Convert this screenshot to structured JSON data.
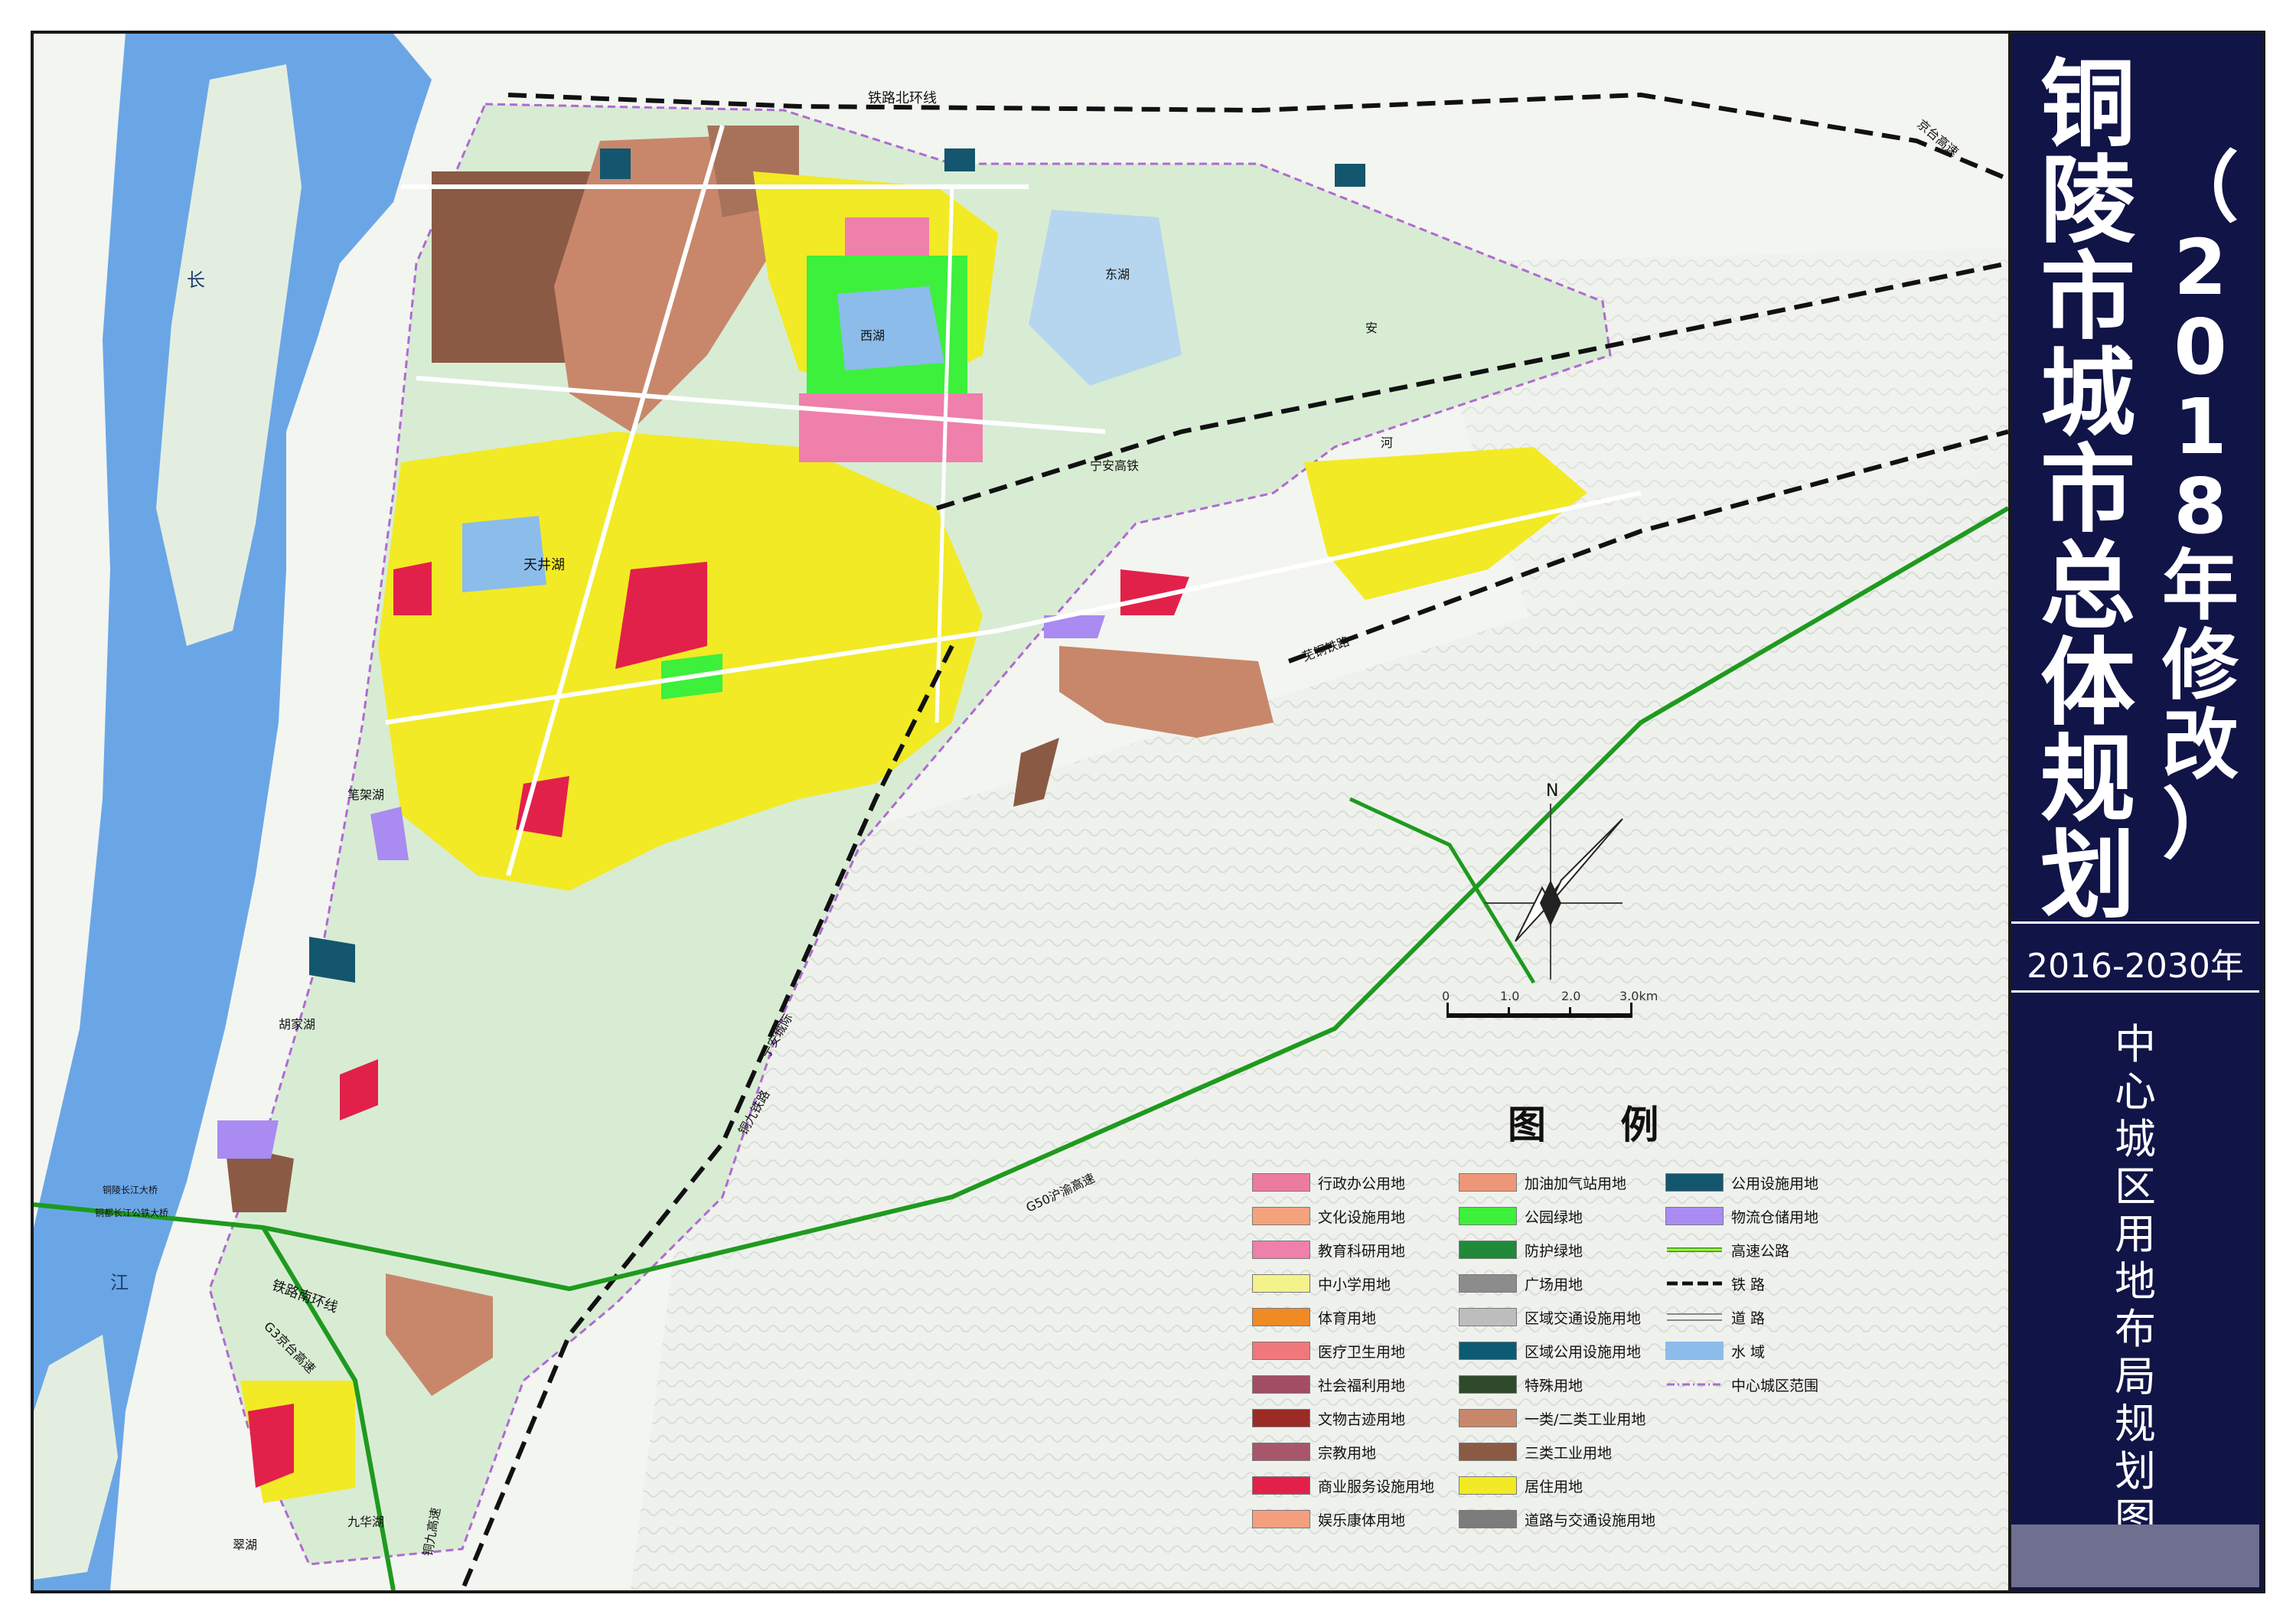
{
  "title": {
    "city_chars": [
      "铜",
      "陵",
      "市",
      "城",
      "市",
      "总",
      "体",
      "规",
      "划"
    ],
    "revision_chars": [
      "（",
      "2",
      "0",
      "1",
      "8",
      "年",
      "修",
      "改",
      "）"
    ],
    "period": "2016-2030年",
    "subtitle_chars": [
      "中",
      "心",
      "城",
      "区",
      "用",
      "地",
      "布",
      "局",
      "规",
      "划",
      "图"
    ]
  },
  "legend": {
    "heading": "图  例",
    "items": [
      {
        "label": "行政办公用地",
        "color": "#ec7ba0",
        "kind": "fill"
      },
      {
        "label": "文化设施用地",
        "color": "#f4a37d",
        "kind": "fill"
      },
      {
        "label": "教育科研用地",
        "color": "#ef7fab",
        "kind": "fill"
      },
      {
        "label": "中小学用地",
        "color": "#f4f28a",
        "kind": "fill"
      },
      {
        "label": "体育用地",
        "color": "#f08a24",
        "kind": "fill"
      },
      {
        "label": "医疗卫生用地",
        "color": "#f0787c",
        "kind": "fill"
      },
      {
        "label": "社会福利用地",
        "color": "#a34d64",
        "kind": "fill"
      },
      {
        "label": "文物古迹用地",
        "color": "#9c2b26",
        "kind": "fill"
      },
      {
        "label": "宗教用地",
        "color": "#a8566a",
        "kind": "fill"
      },
      {
        "label": "商业服务设施用地",
        "color": "#e2214a",
        "kind": "fill"
      },
      {
        "label": "娱乐康体用地",
        "color": "#f4a07f",
        "kind": "fill"
      },
      {
        "label": "加油加气站用地",
        "color": "#ee9778",
        "kind": "fill"
      },
      {
        "label": "公园绿地",
        "color": "#3cf03c",
        "kind": "fill"
      },
      {
        "label": "防护绿地",
        "color": "#1f8a3a",
        "kind": "fill"
      },
      {
        "label": "广场用地",
        "color": "#8c8c8c",
        "kind": "fill"
      },
      {
        "label": "区域交通设施用地",
        "color": "#bdbdbd",
        "kind": "fill"
      },
      {
        "label": "区域公用设施用地",
        "color": "#0d5b72",
        "kind": "fill"
      },
      {
        "label": "特殊用地",
        "color": "#2e4a2a",
        "kind": "fill"
      },
      {
        "label": "一类/二类工业用地",
        "color": "#c8876b",
        "kind": "fill"
      },
      {
        "label": "三类工业用地",
        "color": "#8a5a45",
        "kind": "fill"
      },
      {
        "label": "居住用地",
        "color": "#f2ea24",
        "kind": "fill"
      },
      {
        "label": "道路与交通设施用地",
        "color": "#7c7c7c",
        "kind": "fill"
      },
      {
        "label": "公用设施用地",
        "color": "#14566e",
        "kind": "fill"
      },
      {
        "label": "物流仓储用地",
        "color": "#a98bf2",
        "kind": "fill"
      },
      {
        "label": "高速公路",
        "color": "#b6f03a",
        "kind": "expressway"
      },
      {
        "label": "铁    路",
        "color": "#111111",
        "kind": "railway"
      },
      {
        "label": "道    路",
        "color": "#888888",
        "kind": "road"
      },
      {
        "label": "水    域",
        "color": "#8bbcea",
        "kind": "water"
      },
      {
        "label": "中心城区范围",
        "color": "#b06ad0",
        "kind": "boundary"
      }
    ]
  },
  "compass_label": "N",
  "scale": {
    "ticks": [
      "0",
      "1.0",
      "2.0",
      "3.0km"
    ]
  },
  "map_labels": [
    "长",
    "江",
    "天井湖",
    "西湖",
    "东湖",
    "安",
    "河",
    "铁路北环线",
    "宁安高铁",
    "宁安城际",
    "铜九铁路",
    "G50沪渝高速",
    "铁路南环线",
    "G3京台高速",
    "芜铜铁路",
    "京台高速",
    "铜陵长江大桥",
    "铜都长江公铁大桥",
    "九华湖",
    "铜九高速",
    "翠湖",
    "胡家湖",
    "笔架湖"
  ],
  "colors": {
    "side_panel": "#101447",
    "base_green": "#d8ecd4",
    "river": "#6aa6e6",
    "sandbar": "#e4eee0",
    "residential": "#f2ea24",
    "industry_1_2": "#c8876b",
    "industry_3": "#8a5a45",
    "park": "#3cf03c",
    "expressway": "#1e9a1e"
  }
}
